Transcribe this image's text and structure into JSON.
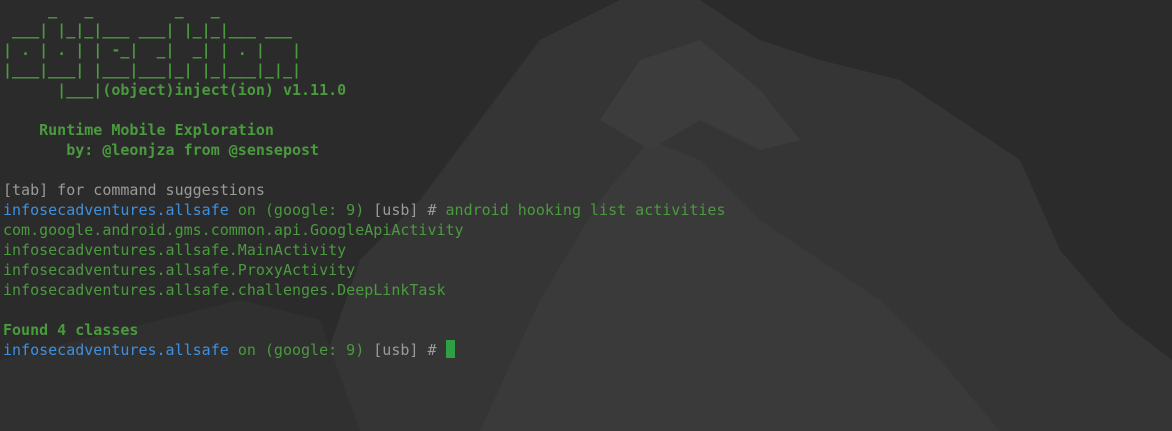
{
  "banner": [
    "     _   _         _   _",
    " ___| |_|_|___ ___| |_|_|___ ___",
    "| . | . | | -_|  _|  _| | . |   |",
    "|___|___| |___|___|_| |_|___|_|_|",
    "      |___|(object)inject(ion) v1.11.0"
  ],
  "subtitle": "    Runtime Mobile Exploration",
  "byline": "       by: @leonjza from @sensepost",
  "hint": "[tab] for command suggestions",
  "prompt": {
    "package": "infosecadventures.allsafe",
    "on": "on",
    "device": "(google: 9)",
    "transport": "[usb]",
    "hash": "#"
  },
  "command": "android hooking list activities",
  "output": [
    "com.google.android.gms.common.api.GoogleApiActivity",
    "infosecadventures.allsafe.MainActivity",
    "infosecadventures.allsafe.ProxyActivity",
    "infosecadventures.allsafe.challenges.DeepLinkTask"
  ],
  "summary": "Found 4 classes",
  "colors": {
    "green": "#4a9a3e",
    "blue": "#3f8fe0",
    "gray": "#9a9a9a",
    "cursor": "#2ea043"
  }
}
